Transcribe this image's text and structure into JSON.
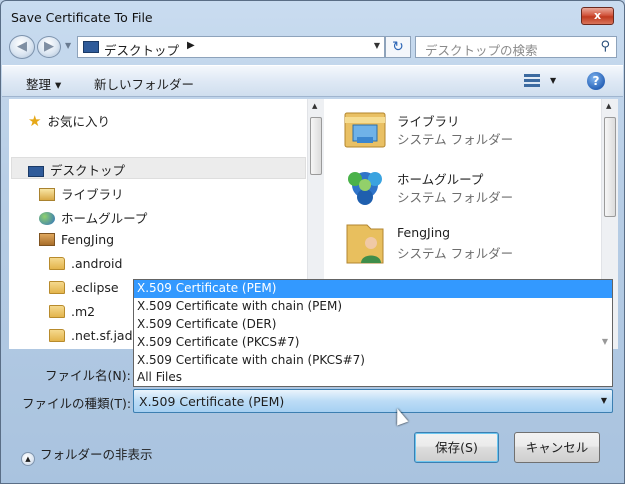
{
  "window": {
    "title": "Save Certificate To File",
    "close_glyph": "x"
  },
  "nav": {
    "back_glyph": "◀",
    "forward_glyph": "▶",
    "address": "デスクトップ",
    "address_arrow": "▶",
    "search_placeholder": "デスクトップの検索",
    "refresh_glyph": "↻",
    "search_icon": "⚲"
  },
  "toolbar": {
    "organize": "整理 ▾",
    "new_folder": "新しいフォルダー",
    "view_drop": "▼",
    "help": "?"
  },
  "tree": {
    "favorites": "お気に入り",
    "desktop": "デスクトップ",
    "libraries": "ライブラリ",
    "homegroup": "ホームグループ",
    "user": "FengJing",
    "folders": [
      ".android",
      ".eclipse",
      ".m2",
      ".net.sf.jadc"
    ]
  },
  "content": [
    {
      "name": "ライブラリ",
      "sub": "システム フォルダー",
      "icon": "library-icon"
    },
    {
      "name": "ホームグループ",
      "sub": "システム フォルダー",
      "icon": "homegroup-icon"
    },
    {
      "name": "FengJing",
      "sub": "システム フォルダー",
      "icon": "user-folder-icon"
    }
  ],
  "form": {
    "filename_label": "ファイル名(N):",
    "filetype_label": "ファイルの種類(T):",
    "filetype_value": "X.509 Certificate (PEM)",
    "filetype_options": [
      "X.509 Certificate (PEM)",
      "X.509 Certificate with chain (PEM)",
      "X.509 Certificate (DER)",
      "X.509 Certificate (PKCS#7)",
      "X.509 Certificate with chain (PKCS#7)",
      "All Files"
    ]
  },
  "footer": {
    "hide_folders": "フォルダーの非表示",
    "save": "保存(S)",
    "cancel": "キャンセル"
  }
}
